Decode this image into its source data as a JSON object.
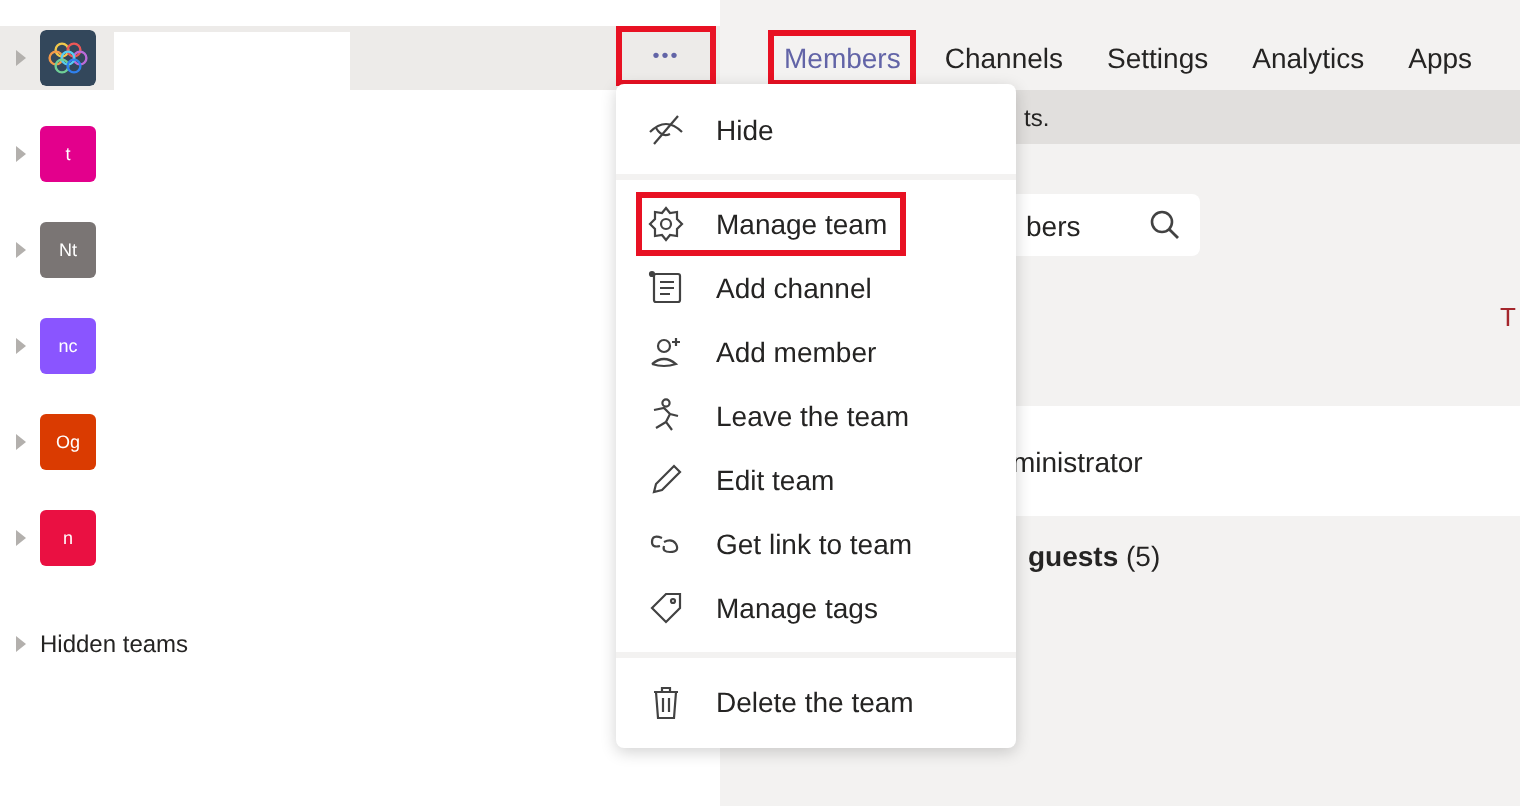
{
  "teams": [
    {
      "kind": "logo",
      "selected": true,
      "color": "#33475b"
    },
    {
      "kind": "initials",
      "initials": "t",
      "selected": false,
      "color": "#e3008c"
    },
    {
      "kind": "initials",
      "initials": "Nt",
      "selected": false,
      "color": "#7a7574"
    },
    {
      "kind": "initials",
      "initials": "nc",
      "selected": false,
      "color": "#8a55ff"
    },
    {
      "kind": "initials",
      "initials": "Og",
      "selected": false,
      "color": "#da3b01"
    },
    {
      "kind": "initials",
      "initials": "n",
      "selected": false,
      "color": "#ea1042"
    }
  ],
  "more_button": {
    "label": "•••",
    "highlighted": true
  },
  "hidden_teams": "Hidden teams",
  "tabs": [
    {
      "label": "Members",
      "selected": true,
      "highlighted": true
    },
    {
      "label": "Channels",
      "selected": false,
      "highlighted": false
    },
    {
      "label": "Settings",
      "selected": false,
      "highlighted": false
    },
    {
      "label": "Analytics",
      "selected": false,
      "highlighted": false
    },
    {
      "label": "Apps",
      "selected": false,
      "highlighted": false
    }
  ],
  "banner": "ts.",
  "search": {
    "placeholder": "bers"
  },
  "column_text": "T",
  "owner_row": "ministrator",
  "guests_heading": "**guests** (5)",
  "menu": {
    "groups": [
      [
        {
          "label": "Hide",
          "highlighted": false
        }
      ],
      [
        {
          "label": "Manage team",
          "highlighted": true
        },
        {
          "label": "Add channel",
          "highlighted": false
        },
        {
          "label": "Add member",
          "highlighted": false
        },
        {
          "label": "Leave the team",
          "highlighted": false
        },
        {
          "label": "Edit team",
          "highlighted": false
        },
        {
          "label": "Get link to team",
          "highlighted": false
        },
        {
          "label": "Manage tags",
          "highlighted": false
        }
      ],
      [
        {
          "label": "Delete the team",
          "highlighted": false
        }
      ]
    ]
  }
}
